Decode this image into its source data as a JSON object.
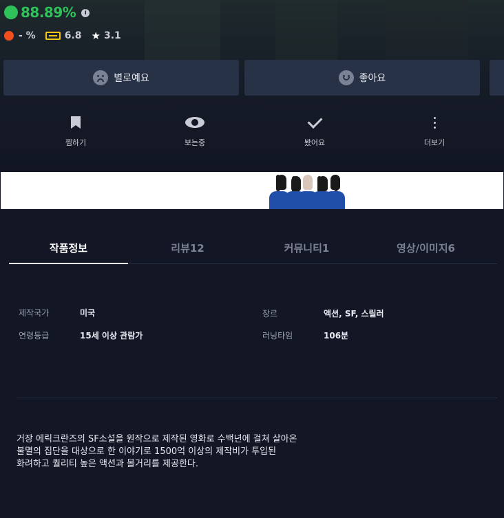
{
  "rating": {
    "score": "88.89%",
    "secondary_score": "- %",
    "imdb_score": "6.8",
    "star_score": "3.1",
    "colors": {
      "positive": "#2fc15a",
      "negative": "#f04e1d",
      "imdb": "#f5c518"
    }
  },
  "vote_buttons": {
    "dislike_label": "별로예요",
    "like_label": "좋아요"
  },
  "actions": {
    "wishlist": "찜하기",
    "watching": "보는중",
    "watched": "봤어요",
    "more": "더보기"
  },
  "tabs": [
    {
      "label": "작품정보",
      "active": true
    },
    {
      "label": "리뷰12",
      "active": false
    },
    {
      "label": "커뮤니티1",
      "active": false
    },
    {
      "label": "영상/이미지6",
      "active": false
    }
  ],
  "info": {
    "country_label": "제작국가",
    "country_value": "미국",
    "age_label": "연령등급",
    "age_value": "15세 이상 관람가",
    "genre_label": "장르",
    "genre_value": "액션, SF, 스릴러",
    "runtime_label": "러닝타임",
    "runtime_value": "106분"
  },
  "description": [
    "거장 에릭크란즈의 SF소설을 원작으로 제작된 영화로 수백년에 걸쳐 살아온",
    "불멸의 집단을 대상으로 한 이야기로 1500억 이상의 제작비가 투입된",
    "화려하고 퀄리티 높은 액션과 볼거리를 제공한다."
  ]
}
